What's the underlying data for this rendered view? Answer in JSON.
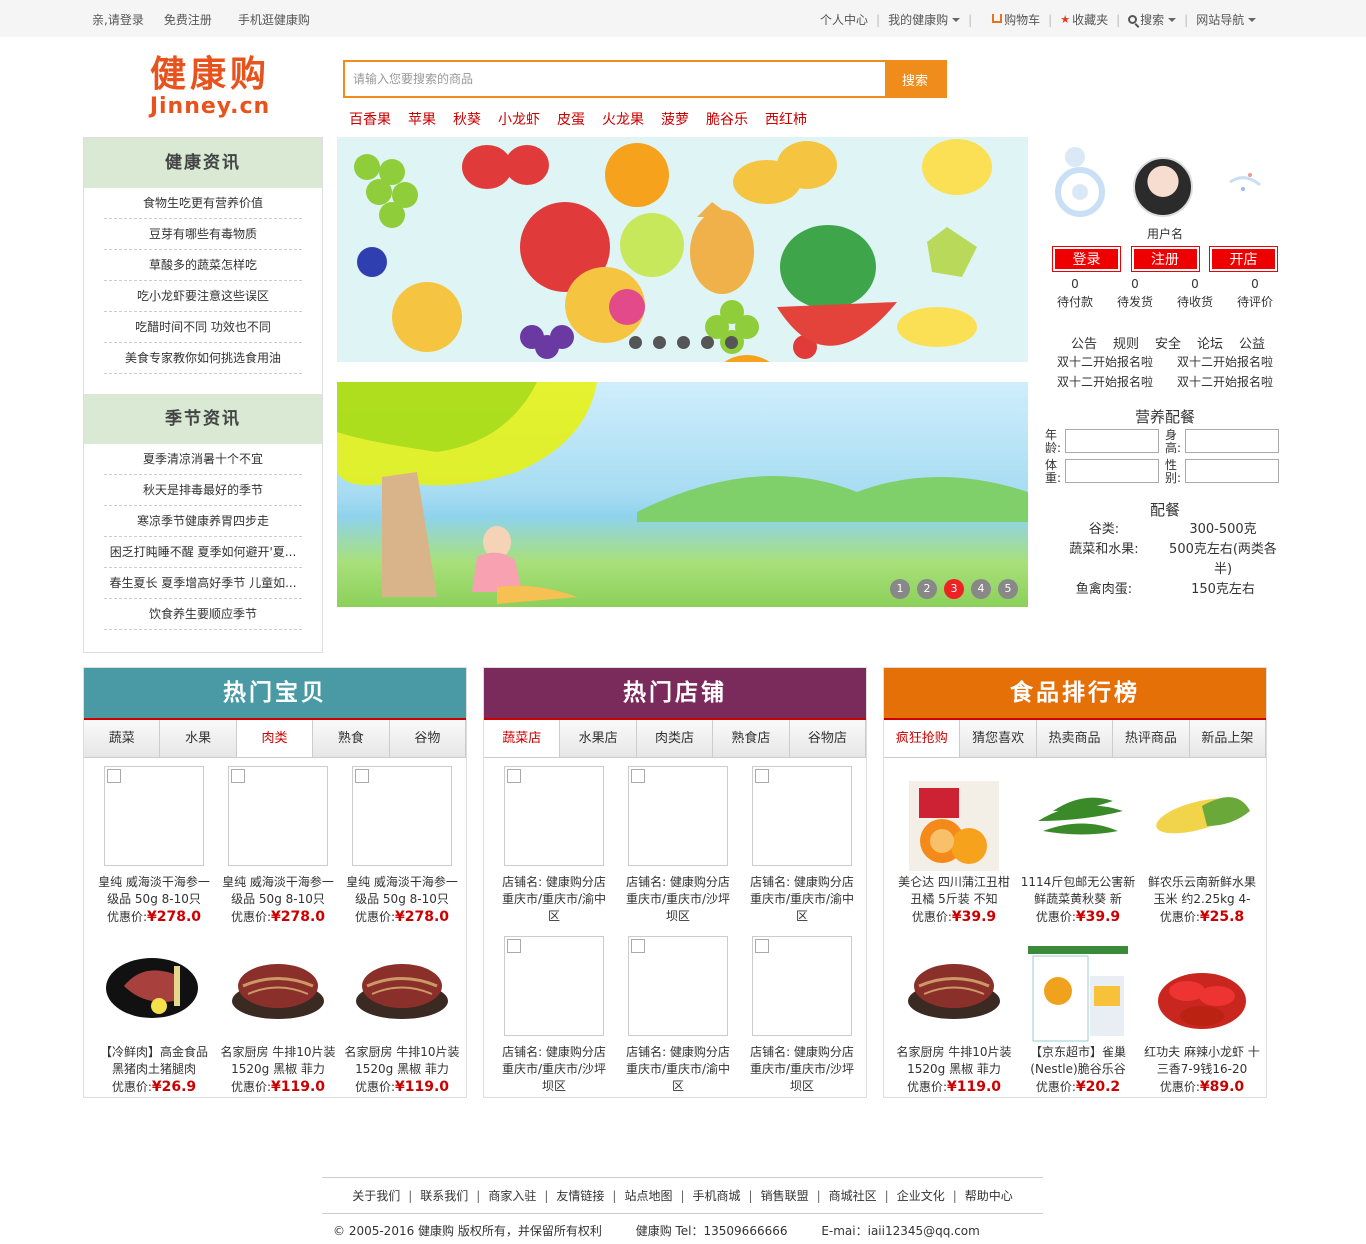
{
  "topbar": {
    "login": "亲,请登录",
    "register": "免费注册",
    "mobile": "手机逛健康购",
    "user_center": "个人中心",
    "my_jinney": "我的健康购",
    "cart": "购物车",
    "favorites": "收藏夹",
    "search": "搜索",
    "site_nav": "网站导航"
  },
  "logo": {
    "cn": "健康购",
    "en": "Jinney.cn"
  },
  "search": {
    "placeholder": "请输入您要搜索的商品",
    "button": "搜索"
  },
  "hotwords": [
    "百香果",
    "苹果",
    "秋葵",
    "小龙虾",
    "皮蛋",
    "火龙果",
    "菠萝",
    "脆谷乐",
    "西红柿"
  ],
  "health_news": {
    "title": "健康资讯",
    "items": [
      "食物生吃更有营养价值",
      "豆芽有哪些有毒物质",
      "草酸多的蔬菜怎样吃",
      "吃小龙虾要注意这些误区",
      "吃醋时间不同 功效也不同",
      "美食专家教你如何挑选食用油"
    ]
  },
  "season_news": {
    "title": "季节资讯",
    "items": [
      "夏季清凉消暑十个不宜",
      "秋天是排毒最好的季节",
      "寒凉季节健康养胃四步走",
      "困乏打盹睡不醒 夏季如何避开'夏...",
      "春生夏长 夏季增高好季节 儿童如...",
      "饮食养生要顺应季节"
    ]
  },
  "banner2_pages": [
    "1",
    "2",
    "3",
    "4",
    "5"
  ],
  "user": {
    "name": "用户名",
    "login": "登录",
    "register": "注册",
    "open_shop": "开店",
    "counts": [
      {
        "n": "0",
        "label": "待付款"
      },
      {
        "n": "0",
        "label": "待发货"
      },
      {
        "n": "0",
        "label": "待收货"
      },
      {
        "n": "0",
        "label": "待评价"
      }
    ]
  },
  "notice": {
    "tabs": [
      "公告",
      "规则",
      "安全",
      "论坛",
      "公益"
    ],
    "rows": [
      [
        "双十二开始报名啦",
        "双十二开始报名啦"
      ],
      [
        "双十二开始报名啦",
        "双十二开始报名啦"
      ]
    ]
  },
  "nutrition": {
    "title": "营养配餐",
    "age": "年龄:",
    "height": "身高:",
    "weight": "体重:",
    "gender": "性别:",
    "meal_title": "配餐",
    "meals": [
      {
        "k": "谷类:",
        "v": "300-500克"
      },
      {
        "k": "蔬菜和水果:",
        "v": "500克左右(两类各半)"
      },
      {
        "k": "鱼禽肉蛋:",
        "v": "150克左右"
      }
    ]
  },
  "hot_items": {
    "title": "热门宝贝",
    "color": "#4a9aa6",
    "tabs": [
      "蔬菜",
      "水果",
      "肉类",
      "熟食",
      "谷物"
    ],
    "products": [
      {
        "name": "皇纯 威海淡干海参一级品 50g 8-10只",
        "label": "优惠价:",
        "price": "¥278.0"
      },
      {
        "name": "皇纯 威海淡干海参一级品 50g 8-10只",
        "label": "优惠价:",
        "price": "¥278.0"
      },
      {
        "name": "皇纯 威海淡干海参一级品 50g 8-10只",
        "label": "优惠价:",
        "price": "¥278.0"
      },
      {
        "name": "【冷鲜肉】高金食品 黑猪肉土猪腿肉",
        "label": "优惠价:",
        "price": "¥26.9"
      },
      {
        "name": "名家厨房 牛排10片装1520g 黑椒 菲力",
        "label": "优惠价:",
        "price": "¥119.0"
      },
      {
        "name": "名家厨房 牛排10片装1520g 黑椒 菲力",
        "label": "优惠价:",
        "price": "¥119.0"
      }
    ]
  },
  "hot_shops": {
    "title": "热门店铺",
    "color": "#7b2a5c",
    "tabs": [
      "蔬菜店",
      "水果店",
      "肉类店",
      "熟食店",
      "谷物店"
    ],
    "shops": [
      {
        "name": "店铺名: 健康购分店",
        "addr": "重庆市/重庆市/渝中区"
      },
      {
        "name": "店铺名: 健康购分店",
        "addr": "重庆市/重庆市/沙坪坝区"
      },
      {
        "name": "店铺名: 健康购分店",
        "addr": "重庆市/重庆市/渝中区"
      },
      {
        "name": "店铺名: 健康购分店",
        "addr": "重庆市/重庆市/沙坪坝区"
      },
      {
        "name": "店铺名: 健康购分店",
        "addr": "重庆市/重庆市/渝中区"
      },
      {
        "name": "店铺名: 健康购分店",
        "addr": "重庆市/重庆市/沙坪坝区"
      }
    ]
  },
  "ranking": {
    "title": "食品排行榜",
    "color": "#e67008",
    "tabs": [
      "疯狂抢购",
      "猜您喜欢",
      "热卖商品",
      "热评商品",
      "新品上架"
    ],
    "products": [
      {
        "name": "美仑达 四川蒲江丑柑丑橘 5斤装 不知",
        "label": "优惠价:",
        "price": "¥39.9"
      },
      {
        "name": "1114斤包邮无公害新鲜蔬菜黄秋葵 新",
        "label": "优惠价:",
        "price": "¥39.9"
      },
      {
        "name": "鲜农乐云南新鲜水果玉米 约2.25kg 4-",
        "label": "优惠价:",
        "price": "¥25.8"
      },
      {
        "name": "名家厨房 牛排10片装1520g 黑椒 菲力",
        "label": "优惠价:",
        "price": "¥119.0"
      },
      {
        "name": "【京东超市】雀巢(Nestle)脆谷乐谷",
        "label": "优惠价:",
        "price": "¥20.2"
      },
      {
        "name": "红功夫 麻辣小龙虾 十三香7-9钱16-20",
        "label": "优惠价:",
        "price": "¥89.0"
      }
    ]
  },
  "footer": {
    "links": [
      "关于我们",
      "联系我们",
      "商家入驻",
      "友情链接",
      "站点地图",
      "手机商城",
      "销售联盟",
      "商城社区",
      "企业文化",
      "帮助中心"
    ],
    "copyright": "© 2005-2016 健康购 版权所有，并保留所有权利",
    "tel": "健康购 Tel：13509666666",
    "email": "E-mai：iaii12345@qq.com"
  }
}
